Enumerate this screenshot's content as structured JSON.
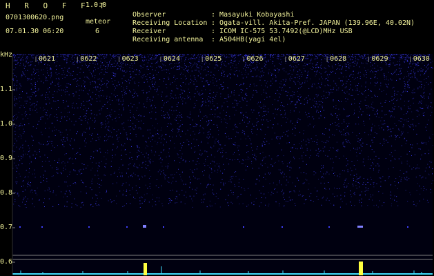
{
  "header": {
    "brand": "H R O F F T",
    "version": "1.0.0",
    "filename": "0701300620.png",
    "datetime": "07.01.30 06:20",
    "meteor_label": "meteor",
    "meteor_count": "6"
  },
  "station": [
    {
      "key": "Observer",
      "sep": ":",
      "value": "Masayuki Kobayashi"
    },
    {
      "key": "Receiving Location",
      "sep": ":",
      "value": "Ogata-vill. Akita-Pref. JAPAN (139.96E, 40.02N)"
    },
    {
      "key": "Receiver",
      "sep": ":",
      "value": "ICOM IC-575 53.7492(@LCD)MHz USB"
    },
    {
      "key": "Receiving antenna",
      "sep": ":",
      "value": "A504HB(yagi 4el)"
    }
  ],
  "chart_data": {
    "type": "heatmap",
    "ylabel": "kHz",
    "y_ticks": [
      "1.1",
      "1.0",
      "0.9",
      "0.8",
      "0.7",
      "0.6"
    ],
    "ylim": [
      0.58,
      1.2
    ],
    "x_ticks": [
      "0621",
      "0622",
      "0623",
      "0624",
      "0625",
      "0626",
      "0627",
      "0628",
      "0629",
      "0630"
    ],
    "colors": {
      "background": "#000010",
      "noise": "#4040ff",
      "echo": "#ffff40",
      "trace": "#40e0ff",
      "guide": "#808080"
    },
    "echo_frequency_khz": 0.7,
    "meteor_columns": [
      "0623",
      "0628"
    ]
  }
}
